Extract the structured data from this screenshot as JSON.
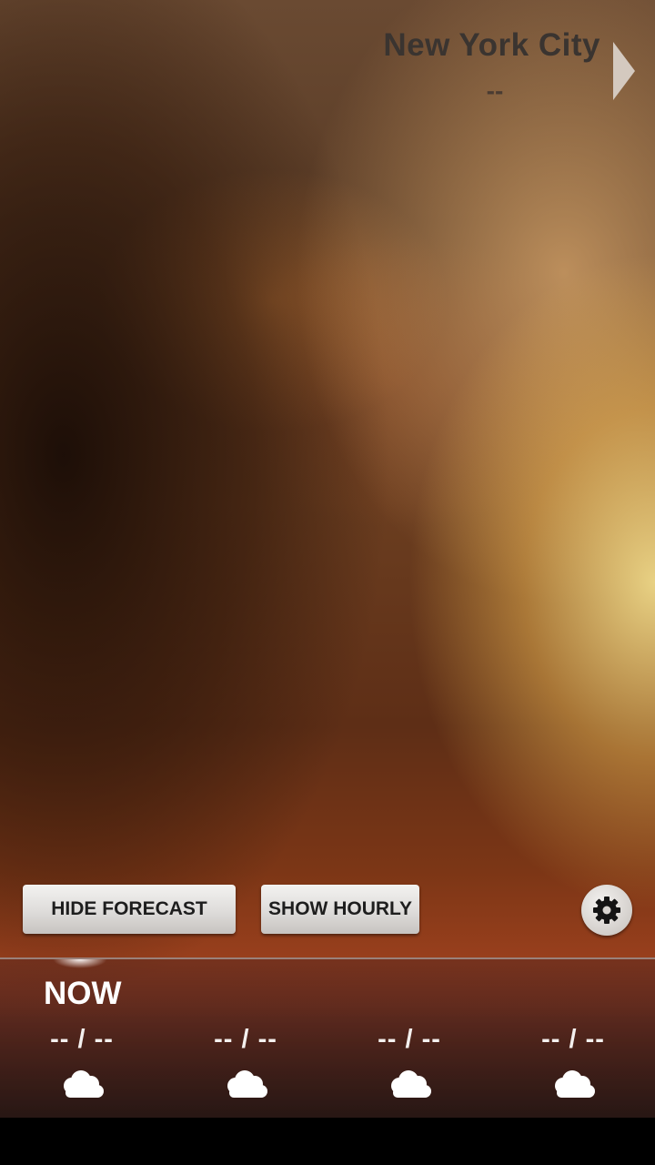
{
  "header": {
    "city": "New York City",
    "subtitle": "--"
  },
  "buttons": {
    "hide_forecast": "HIDE FORECAST",
    "show_hourly": "SHOW HOURLY"
  },
  "forecast": {
    "now_label": "NOW",
    "days": [
      {
        "temp": "-- / --",
        "icon": "cloud-icon"
      },
      {
        "temp": "-- / --",
        "icon": "cloud-icon"
      },
      {
        "temp": "-- / --",
        "icon": "cloud-icon"
      },
      {
        "temp": "-- / --",
        "icon": "cloud-icon"
      }
    ]
  },
  "colors": {
    "city_text": "#3a3430",
    "button_text": "#1e1e1e",
    "forecast_text": "#ffffff"
  }
}
